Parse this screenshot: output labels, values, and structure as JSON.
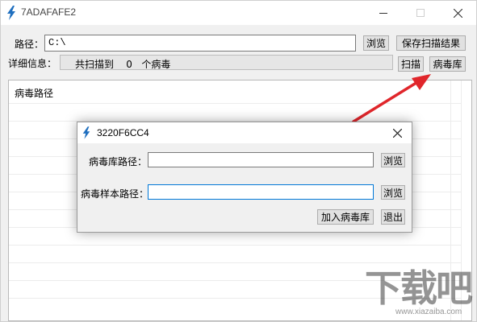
{
  "window": {
    "title": "7ADAFAFE2"
  },
  "toolbar": {
    "path_label": "路径：",
    "path_value": "C:\\",
    "browse_label": "浏览",
    "save_label": "保存扫描结果",
    "detail_label": "详细信息：",
    "detail_prefix": "共扫描到",
    "detail_count": "0",
    "detail_suffix": "个病毒",
    "scan_label": "扫描",
    "virus_lib_label": "病毒库"
  },
  "list": {
    "header": "病毒路径"
  },
  "dialog": {
    "title": "3220F6CC4",
    "lib_path_label": "病毒库路径：",
    "lib_path_value": "",
    "sample_path_label": "病毒样本路径：",
    "sample_path_value": "",
    "browse_label_1": "浏览",
    "browse_label_2": "浏览",
    "add_lib_label": "加入病毒库",
    "exit_label": "退出"
  },
  "watermark": {
    "main": "下载吧",
    "url": "www.xiazaiba.com"
  },
  "colors": {
    "arrow": "#e0262b",
    "icon": "#1f6fbf",
    "focus_border": "#0078d7"
  },
  "icons": {
    "app": "lightning-bolt-icon",
    "close": "close-icon",
    "minimize": "minimize-icon",
    "maximize": "maximize-icon"
  }
}
